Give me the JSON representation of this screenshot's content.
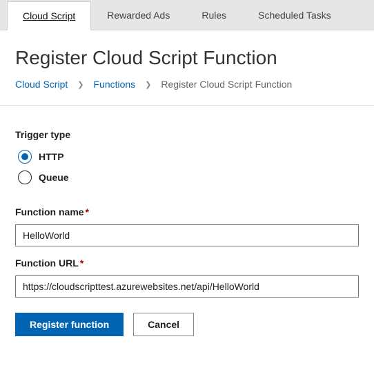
{
  "tabs": [
    {
      "label": "Cloud Script",
      "active": true
    },
    {
      "label": "Rewarded Ads",
      "active": false
    },
    {
      "label": "Rules",
      "active": false
    },
    {
      "label": "Scheduled Tasks",
      "active": false
    }
  ],
  "page_title": "Register Cloud Script Function",
  "breadcrumb": {
    "items": [
      {
        "label": "Cloud Script",
        "link": true
      },
      {
        "label": "Functions",
        "link": true
      },
      {
        "label": "Register Cloud Script Function",
        "link": false
      }
    ]
  },
  "form": {
    "trigger_type": {
      "label": "Trigger type",
      "options": [
        {
          "label": "HTTP",
          "checked": true
        },
        {
          "label": "Queue",
          "checked": false
        }
      ]
    },
    "function_name": {
      "label": "Function name",
      "required": true,
      "value": "HelloWorld"
    },
    "function_url": {
      "label": "Function URL",
      "required": true,
      "value": "https://cloudscripttest.azurewebsites.net/api/HelloWorld"
    }
  },
  "buttons": {
    "primary": "Register function",
    "secondary": "Cancel"
  }
}
